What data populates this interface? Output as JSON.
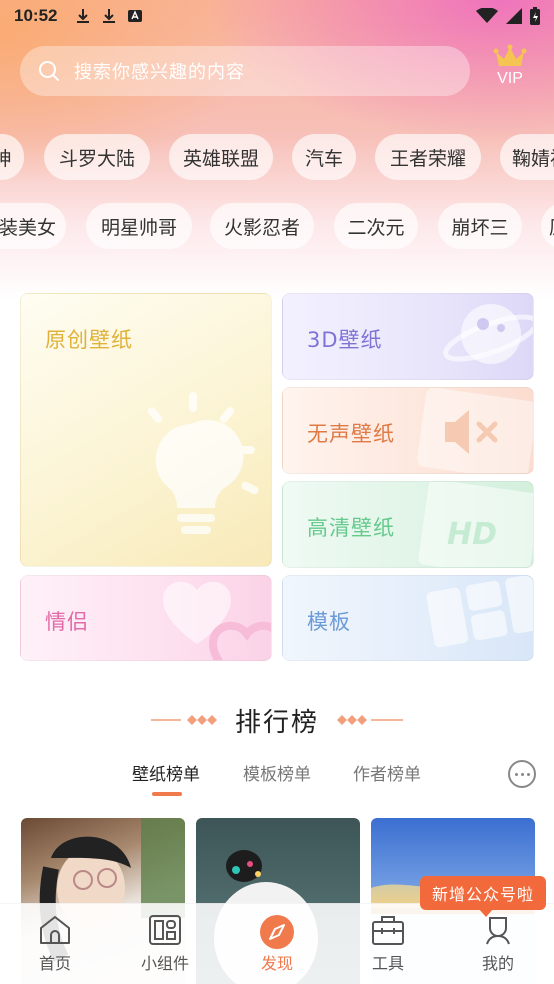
{
  "status_bar": {
    "time": "10:52"
  },
  "search": {
    "placeholder": "搜索你感兴趣的内容"
  },
  "vip": {
    "label": "VIP"
  },
  "tags_row1": [
    "神",
    "斗罗大陆",
    "英雄联盟",
    "汽车",
    "王者荣耀",
    "鞠婧祎"
  ],
  "tags_row2": [
    "装美女",
    "明星帅哥",
    "火影忍者",
    "二次元",
    "崩坏三",
    "原"
  ],
  "categories": {
    "original": "原创壁纸",
    "three_d": "3D壁纸",
    "silent": "无声壁纸",
    "hd": "高清壁纸",
    "couple": "情侣",
    "template": "模板"
  },
  "ranking": {
    "title": "排行榜",
    "tabs": [
      "壁纸榜单",
      "模板榜单",
      "作者榜单"
    ],
    "active_tab": "壁纸榜单"
  },
  "toast": {
    "text": "新增公众号啦"
  },
  "tabbar": {
    "items": [
      "首页",
      "小组件",
      "发现",
      "工具",
      "我的"
    ],
    "active": "发现"
  },
  "colors": {
    "accent": "#f07a4c",
    "original_text": "#e0b23a",
    "three_d_text": "#7f74d6",
    "silent_text": "#e07a45",
    "hd_text": "#66c98d",
    "couple_text": "#e26aa8",
    "template_text": "#6c9ad6"
  }
}
